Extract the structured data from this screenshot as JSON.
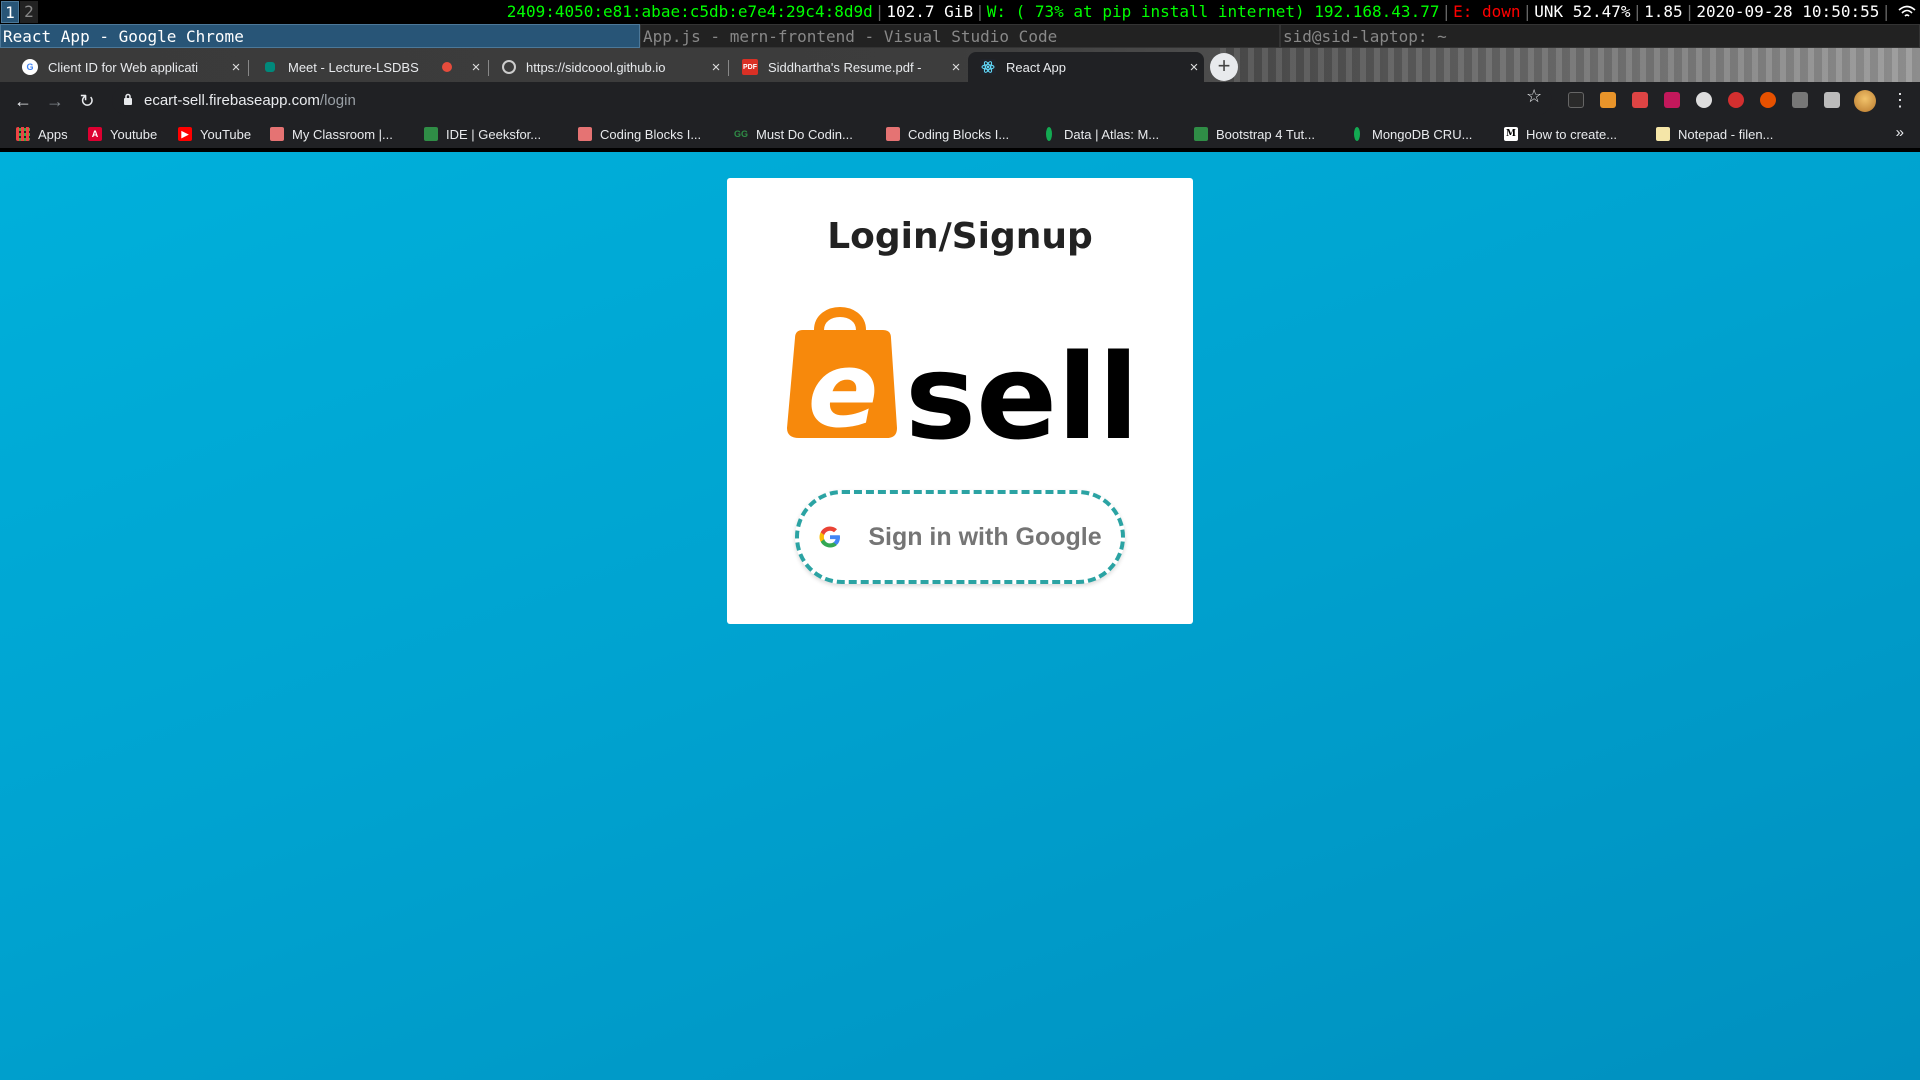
{
  "i3bar": {
    "workspaces": [
      "1",
      "2"
    ],
    "ipv6": "2409:4050:e81:abae:c5db:e7e4:29c4:8d9d",
    "disk": "102.7 GiB",
    "wireless": "W: ( 73% at pip install internet) 192.168.43.77",
    "ethernet": "E: down",
    "battery": "UNK 52.47%",
    "load": "1.85",
    "datetime": "2020-09-28 10:50:55"
  },
  "window_titles": [
    "React App - Google Chrome",
    "App.js - mern-frontend - Visual Studio Code",
    "sid@sid-laptop: ~"
  ],
  "tabs": [
    {
      "label": "Client ID for Web applicati",
      "icon": "google-icon"
    },
    {
      "label": "Meet - Lecture-LSDBS",
      "icon": "meet-icon"
    },
    {
      "label": "https://sidcoool.github.io",
      "icon": "globe-icon"
    },
    {
      "label": "Siddhartha's Resume.pdf -",
      "icon": "pdf-icon",
      "icon_text": "PDF"
    },
    {
      "label": "React App",
      "icon": "react-icon"
    }
  ],
  "omnibox": {
    "host": "ecart-sell.firebaseapp.com",
    "path": "/login"
  },
  "bookmarks": [
    {
      "label": "Apps",
      "icon": "apps-icon"
    },
    {
      "label": "Youtube",
      "icon": "angular-icon",
      "icon_text": "A"
    },
    {
      "label": "YouTube",
      "icon": "youtube-icon"
    },
    {
      "label": "My Classroom |...",
      "icon": "cube-icon"
    },
    {
      "label": "IDE | Geeksfor...",
      "icon": "gfg-icon"
    },
    {
      "label": "Coding Blocks I...",
      "icon": "cube-icon"
    },
    {
      "label": "Must Do Codin...",
      "icon": "gfg-icon"
    },
    {
      "label": "Coding Blocks I...",
      "icon": "cube-icon"
    },
    {
      "label": "Data | Atlas: M...",
      "icon": "mongodb-leaf-icon"
    },
    {
      "label": "Bootstrap 4 Tut...",
      "icon": "gfg-icon"
    },
    {
      "label": "MongoDB CRU...",
      "icon": "mongodb-leaf-icon"
    },
    {
      "label": "How to create...",
      "icon": "medium-icon",
      "icon_text": "M"
    },
    {
      "label": "Notepad - filen...",
      "icon": "notepad-icon"
    }
  ],
  "card": {
    "title": "Login/Signup",
    "logo_text": "sell",
    "logo_letter": "e",
    "google_button": "Sign in with Google"
  },
  "colors": {
    "page_bg": "#00a3d0",
    "logo_orange": "#f7890c",
    "button_border": "#2ba3a3"
  }
}
